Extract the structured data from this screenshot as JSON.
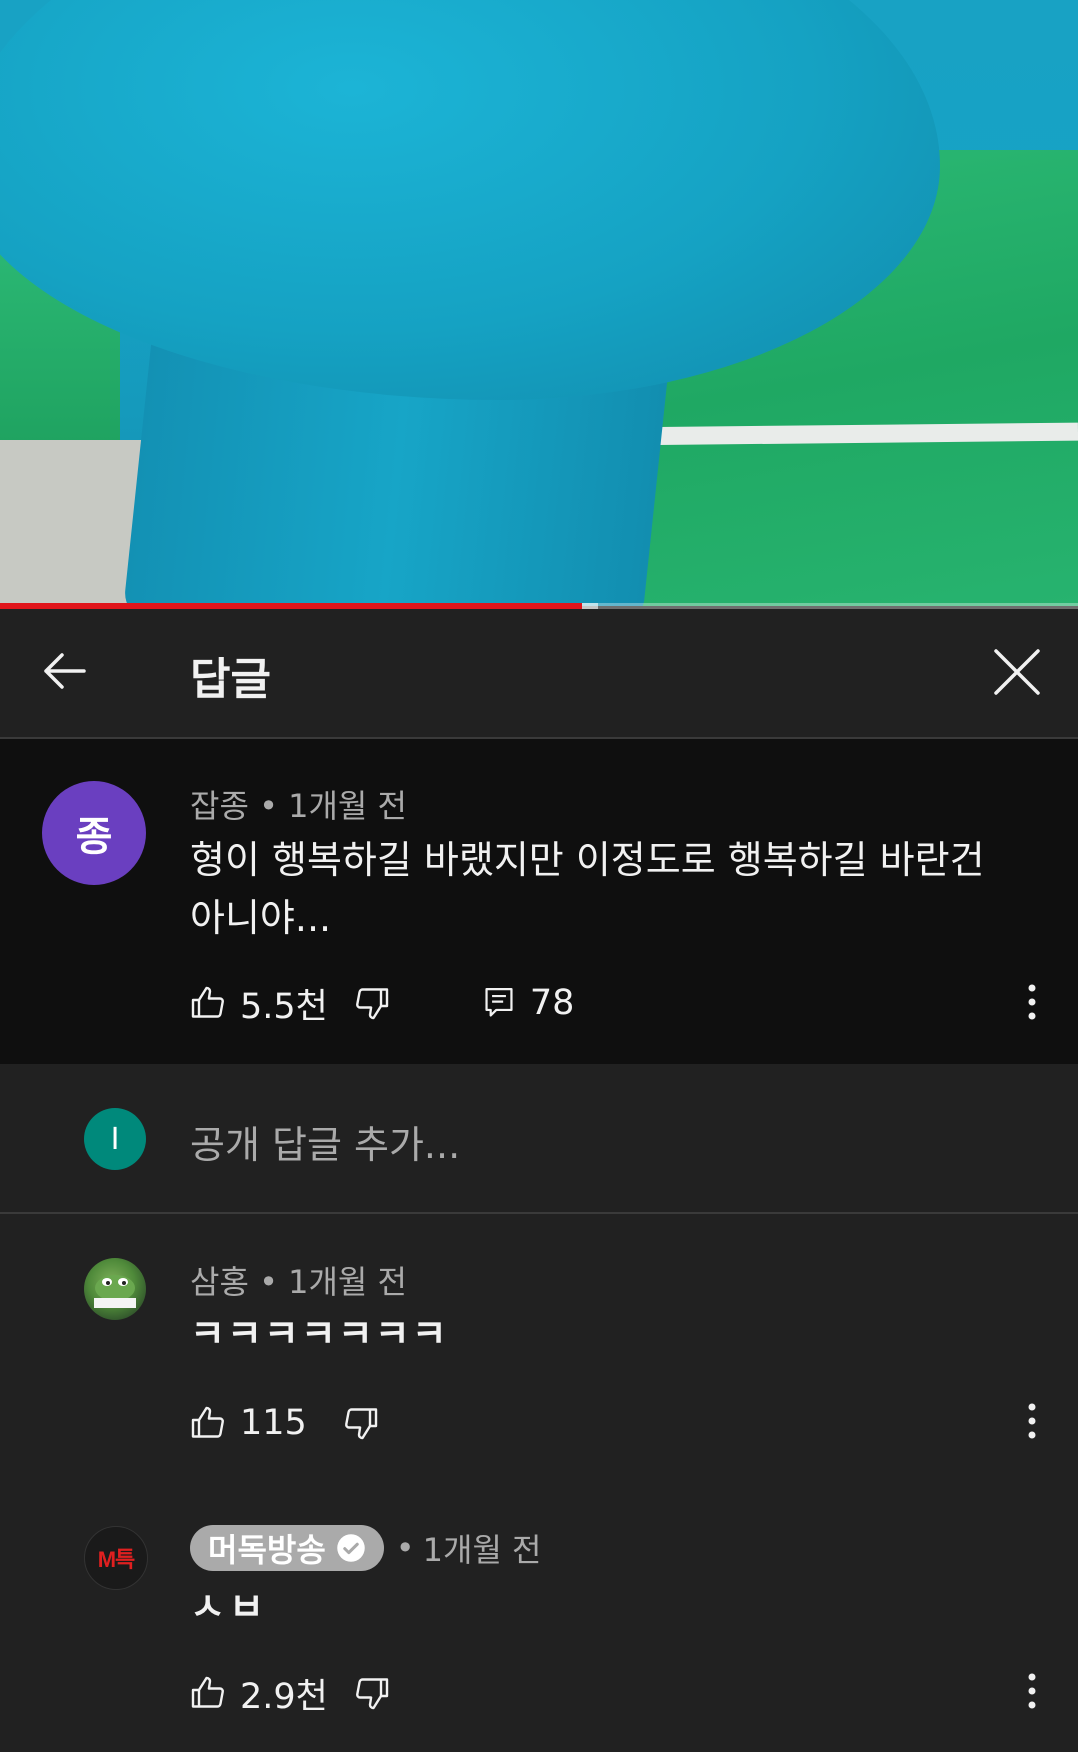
{
  "video": {
    "progress": 0.54,
    "buffered": 0.555
  },
  "header": {
    "title": "답글"
  },
  "parent_comment": {
    "avatar_letter": "종",
    "avatar_color": "#6a3fc0",
    "author": "잡종",
    "time": "1개월 전",
    "text": "형이 행복하길 바랬지만 이정도로 행복하길 바란건 아니야...",
    "likes": "5.5천",
    "replies": "78"
  },
  "add_reply": {
    "avatar_letter": "I",
    "avatar_color": "#00897b",
    "placeholder": "공개 답글 추가..."
  },
  "replies": [
    {
      "author": "삼홍",
      "time": "1개월 전",
      "text": "ㅋㅋㅋㅋㅋㅋㅋ",
      "likes": "115"
    },
    {
      "author": "머독방송",
      "verified": true,
      "time": "1개월 전",
      "text": "ㅅㅂ",
      "likes": "2.9천",
      "avatar_text": "M특"
    }
  ],
  "meta_separator": "•"
}
